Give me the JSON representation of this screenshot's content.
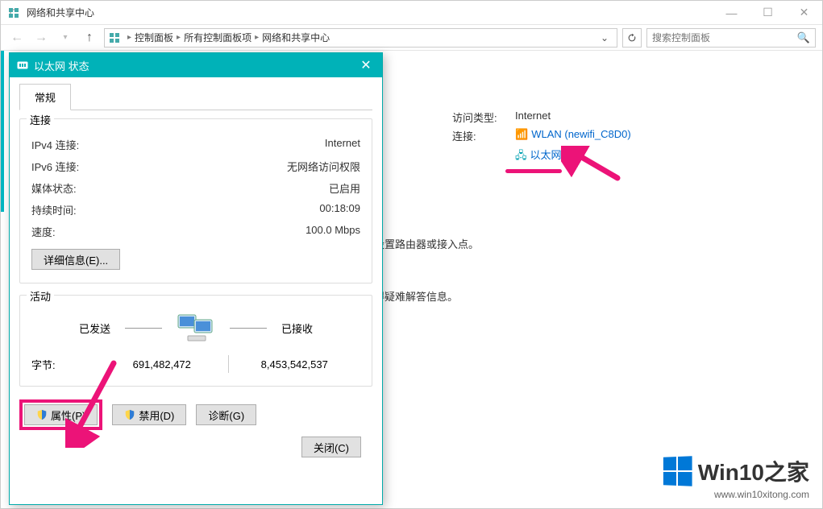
{
  "mainWindow": {
    "title": "网络和共享中心",
    "breadcrumb": {
      "items": [
        "控制面板",
        "所有控制面板项",
        "网络和共享中心"
      ]
    },
    "searchPlaceholder": "搜索控制面板"
  },
  "networkInfo": {
    "accessTypeLabel": "访问类型:",
    "accessTypeValue": "Internet",
    "connectionsLabel": "连接:",
    "wlanName": "WLAN (newifi_C8D0)",
    "ethernetName": "以太网",
    "bodyLine1": "或设置路由器或接入点。",
    "bodyLine2": "获得疑难解答信息。"
  },
  "dialog": {
    "title": "以太网 状态",
    "tab": "常规",
    "connectionGroup": {
      "label": "连接",
      "ipv4Label": "IPv4 连接:",
      "ipv4Value": "Internet",
      "ipv6Label": "IPv6 连接:",
      "ipv6Value": "无网络访问权限",
      "mediaLabel": "媒体状态:",
      "mediaValue": "已启用",
      "durationLabel": "持续时间:",
      "durationValue": "00:18:09",
      "speedLabel": "速度:",
      "speedValue": "100.0 Mbps",
      "detailsBtn": "详细信息(E)..."
    },
    "activityGroup": {
      "label": "活动",
      "sentLabel": "已发送",
      "receivedLabel": "已接收",
      "bytesLabel": "字节:",
      "bytesSent": "691,482,472",
      "bytesReceived": "8,453,542,537"
    },
    "buttons": {
      "properties": "属性(P)",
      "disable": "禁用(D)",
      "diagnose": "诊断(G)",
      "close": "关闭(C)"
    }
  },
  "watermark": {
    "brand": "Win10",
    "sub": "之家",
    "url": "www.win10xitong.com"
  }
}
